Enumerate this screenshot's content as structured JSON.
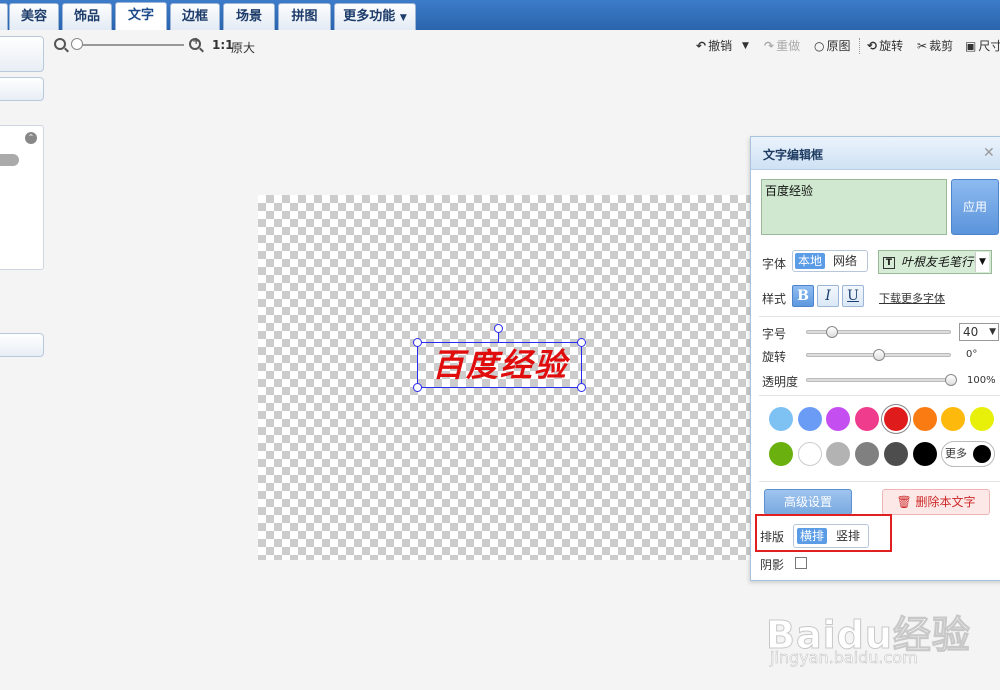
{
  "tabs": [
    {
      "label": "美容",
      "active": false
    },
    {
      "label": "饰品",
      "active": false
    },
    {
      "label": "文字",
      "active": true
    },
    {
      "label": "边框",
      "active": false
    },
    {
      "label": "场景",
      "active": false
    },
    {
      "label": "拼图",
      "active": false
    },
    {
      "label": "更多功能",
      "active": false
    }
  ],
  "zoom": {
    "ratio_label": "1:1",
    "original_label": "原大"
  },
  "toolbar": {
    "undo": "撤销",
    "redo": "重做",
    "original": "原图",
    "rotate": "旋转",
    "crop": "裁剪",
    "resize": "尺寸"
  },
  "canvas": {
    "text": "百度经验",
    "text_color": "#e10c0c"
  },
  "editor": {
    "title": "文字编辑框",
    "close": "✕",
    "text_value": "百度经验",
    "apply": "应用",
    "font_label": "字体",
    "font_source": {
      "local": "本地",
      "web": "网络",
      "selected": "本地"
    },
    "font_name": "叶根友毛笔行书",
    "style_label": "样式",
    "style_buttons": {
      "bold": "B",
      "italic": "I",
      "underline": "U",
      "bold_on": true
    },
    "download_fonts": "下载更多字体",
    "size_label": "字号",
    "size_value": "40",
    "rotate_label": "旋转",
    "rotate_value": "0°",
    "opacity_label": "透明度",
    "opacity_value": "100%",
    "rotate_fraction": 0.5,
    "size_fraction": 0.18,
    "opacity_fraction": 1.0,
    "colors_row1": [
      "#7ec2f4",
      "#6a9cf5",
      "#c54ef0",
      "#f03c8c",
      "#e01b1b",
      "#fb7b13",
      "#fdb90c",
      "#e8f00a"
    ],
    "colors_row2": [
      "#6ab00e",
      "#ffffff",
      "#b3b3b3",
      "#808080",
      "#4d4d4d",
      "#000000"
    ],
    "selected_color": "#e01b1b",
    "more_colors": "更多",
    "advanced": "高级设置",
    "delete": "删除本文字",
    "layout_label": "排版",
    "layout_options": {
      "horizontal": "横排",
      "vertical": "竖排",
      "selected": "横排"
    },
    "shadow_label": "阴影"
  },
  "watermark": {
    "brand": "Baidu经验",
    "sub": "jingyan.baidu.com"
  }
}
